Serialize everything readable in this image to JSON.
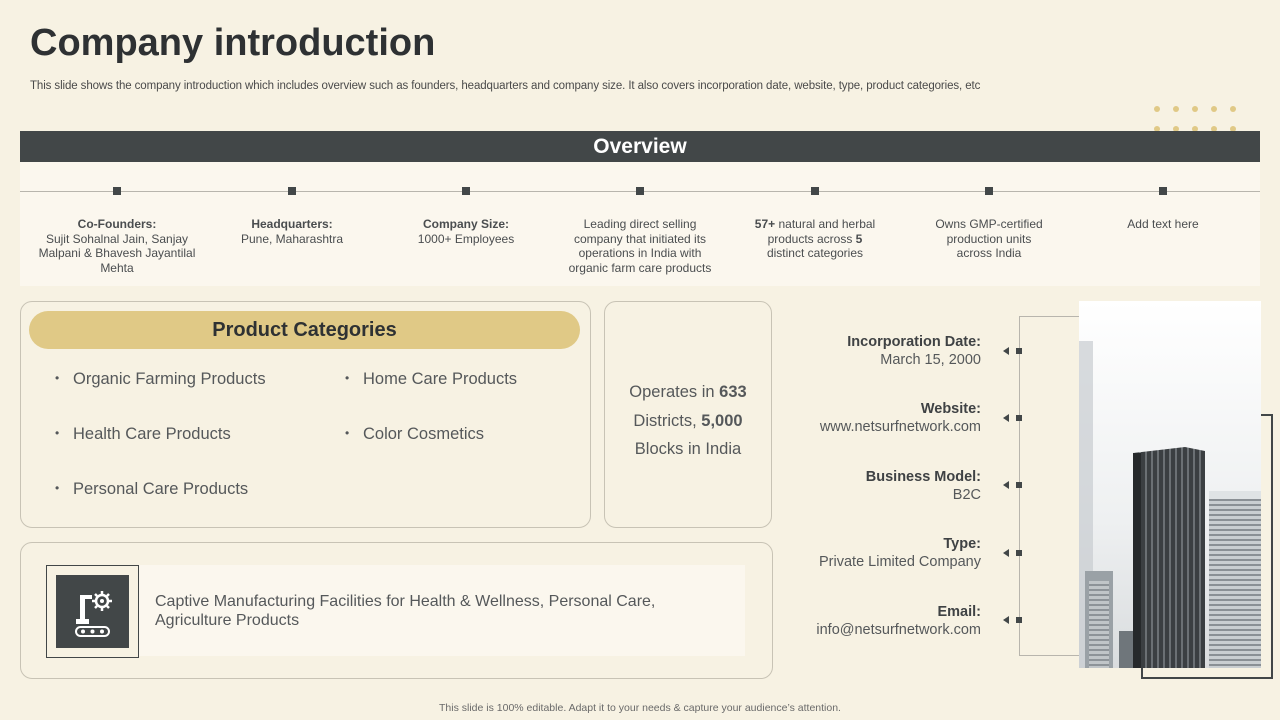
{
  "slide": {
    "title": "Company introduction",
    "subtitle": "This slide shows the company introduction which includes overview such as founders, headquarters and company size. It also covers incorporation date, website, type, product categories, etc",
    "footer": "This slide is 100% editable.  Adapt it to your needs & capture your audience’s attention."
  },
  "overview": {
    "heading": "Overview",
    "items": [
      {
        "bold": "Co-Founders:",
        "text": "Sujit Sohalnal Jain, Sanjay Malpani & Bhavesh Jayantilal Mehta"
      },
      {
        "bold": "Headquarters:",
        "text": "Pune, Maharashtra"
      },
      {
        "bold": "Company  Size:",
        "text": "1000+ Employees"
      },
      {
        "bold": "",
        "text": "Leading direct selling company that initiated its operations in India with organic farm care products"
      },
      {
        "bold": "57+",
        "text": " natural and herbal products across ",
        "bold2": "5",
        "text2": " distinct categories"
      },
      {
        "bold": "",
        "text": "Owns GMP-certified production units across India"
      },
      {
        "bold": "",
        "text": "Add text here"
      }
    ]
  },
  "product_categories": {
    "heading": "Product Categories",
    "bullet": "•",
    "items": [
      "Organic Farming Products",
      "Home Care Products",
      "Health Care Products",
      "Color Cosmetics",
      "Personal Care Products"
    ]
  },
  "operations": {
    "line1_prefix": "Operates in ",
    "line1_bold": "633",
    "line2_prefix": "Districts, ",
    "line2_bold": "5,000",
    "line3": "Blocks in India"
  },
  "manufacturing": {
    "icon": "factory-robot-arm-icon",
    "line1": "Captive Manufacturing  Facilities for Health & Wellness,  Personal Care,",
    "line2": "Agriculture  Products"
  },
  "company_info": [
    {
      "label": "Incorporation Date:",
      "value": "March 15, 2000"
    },
    {
      "label": "Website:",
      "value": "www.netsurfnetwork.com"
    },
    {
      "label": "Business Model:",
      "value": "B2C"
    },
    {
      "label": "Type:",
      "value": "Private Limited Company"
    },
    {
      "label": "Email:",
      "value": "info@netsurfnetwork.com"
    }
  ],
  "colors": {
    "background": "#f7f2e3",
    "dark": "#424748",
    "accent_gold": "#e0c986",
    "panel": "#fbf7ee"
  }
}
